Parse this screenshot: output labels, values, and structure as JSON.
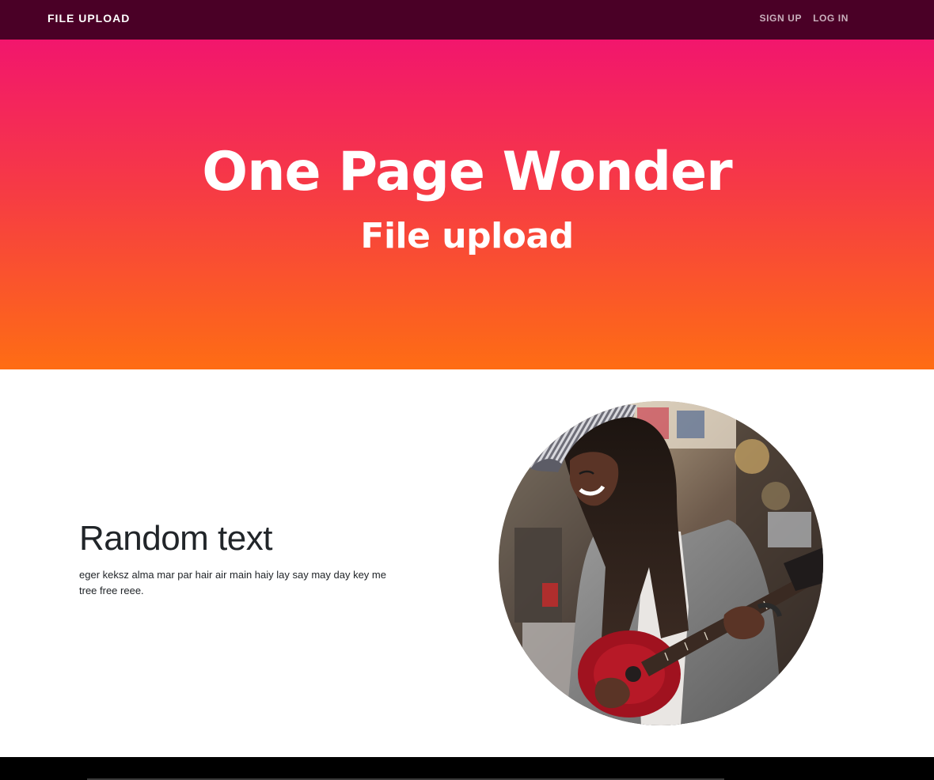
{
  "navbar": {
    "brand": "FILE UPLOAD",
    "links": [
      {
        "label": "SIGN UP"
      },
      {
        "label": "LOG IN"
      }
    ],
    "background": "#4a0026"
  },
  "hero": {
    "title": "One Page Wonder",
    "subtitle": "File upload",
    "gradient": [
      "#f2166d",
      "#f63a45",
      "#fe6d14"
    ]
  },
  "section": {
    "heading": "Random text",
    "body": "eger keksz alma mar par hair air main haiy lay say may day key me tree free reee."
  },
  "photo": {
    "subject": "woman-playing-guitar-photo"
  }
}
